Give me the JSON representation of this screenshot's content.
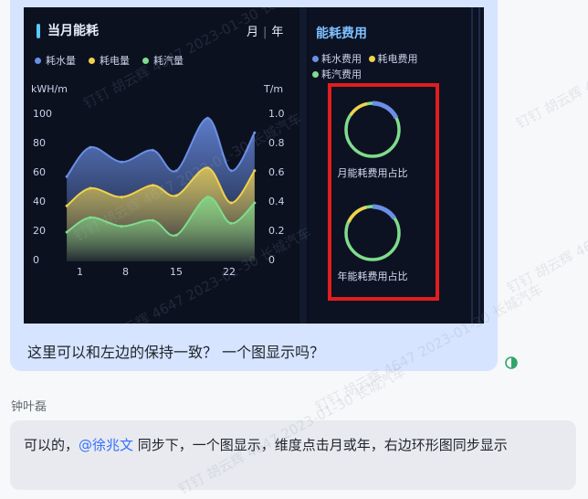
{
  "screenshot": {
    "left": {
      "title": "当月能耗",
      "period_month": "月",
      "period_year": "年",
      "legend": [
        {
          "label": "耗水量",
          "color": "#6b8fe6"
        },
        {
          "label": "耗电量",
          "color": "#f1d24a"
        },
        {
          "label": "耗汽量",
          "color": "#7fdc8c"
        }
      ],
      "y_left_unit": "kWH/m",
      "y_right_unit": "T/m",
      "y_left_ticks": [
        "100",
        "80",
        "60",
        "40",
        "20",
        "0"
      ],
      "y_right_ticks": [
        "1.0",
        "0.8",
        "0.6",
        "0.4",
        "0.2",
        "0"
      ],
      "x_ticks": [
        "1",
        "8",
        "15",
        "22"
      ]
    },
    "right": {
      "title": "能耗费用",
      "legend": [
        {
          "label": "耗水费用",
          "color": "#6b8fe6"
        },
        {
          "label": "耗电费用",
          "color": "#f1d24a"
        },
        {
          "label": "耗汽费用",
          "color": "#7fdc8c"
        }
      ],
      "ring1_label": "月能耗费用占比",
      "ring2_label": "年能耗费用占比"
    }
  },
  "chart_data": {
    "type": "area",
    "title": "当月能耗",
    "ylabel": "kWH/m",
    "ylabel_right": "T/m",
    "ylim": [
      0,
      100
    ],
    "ylim_right": [
      0,
      1.0
    ],
    "x": [
      1,
      4,
      8,
      12,
      15,
      19,
      22,
      25
    ],
    "xlim": [
      -1,
      27
    ],
    "series": [
      {
        "name": "耗水量",
        "color": "#6b8fe6",
        "values": [
          58,
          78,
          68,
          76,
          62,
          98,
          62,
          88
        ]
      },
      {
        "name": "耗电量",
        "color": "#f1d24a",
        "values": [
          38,
          50,
          44,
          52,
          45,
          64,
          40,
          62
        ]
      },
      {
        "name": "耗汽量",
        "color": "#7fdc8c",
        "values": [
          20,
          30,
          24,
          28,
          18,
          44,
          26,
          40
        ]
      }
    ]
  },
  "message": {
    "text": "这里可以和左边的保持一致？ 一个图显示吗？"
  },
  "reply": {
    "sender": "钟叶磊",
    "text_before": "可以的，",
    "mention": "@徐兆文",
    "text_after": " 同步下，一个图显示，维度点击月或年，右边环形图同步显示"
  },
  "watermark": {
    "text": "钉钉 胡云辉 4647 2023-01-30 长城汽车"
  }
}
